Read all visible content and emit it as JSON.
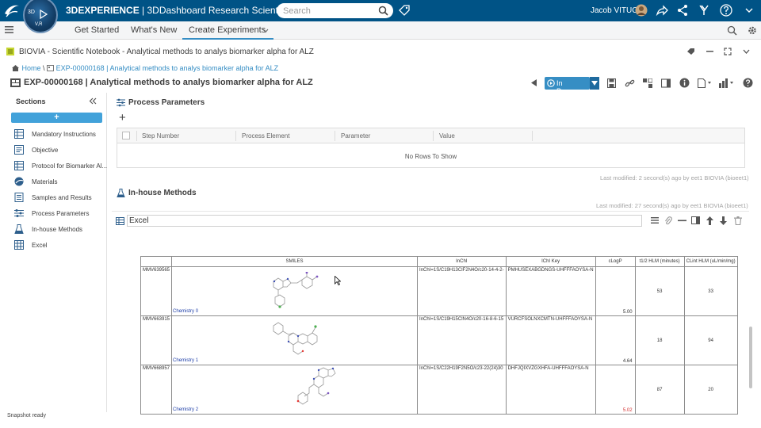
{
  "topbar": {
    "brand_bold": "3DEXPERIENCE",
    "brand_rest": " | 3DDashboard  Research Scientist",
    "search_placeholder": "Search",
    "user_name": "Jacob VITUCCI",
    "compass_3d": "3D",
    "compass_vr": "V,R"
  },
  "tabs": [
    {
      "label": "Get Started"
    },
    {
      "label": "What's New"
    },
    {
      "label": "Create Experiments"
    }
  ],
  "appbar": {
    "title": "BIOVIA - Scientific Notebook - Analytical methods to analys biomarker alpha for ALZ"
  },
  "breadcrumb": {
    "home": "Home",
    "sep": "\\",
    "experiment": "EXP-00000168 | Analytical methods to analys biomarker alpha for ALZ"
  },
  "experiment": {
    "title": "EXP-00000168 | Analytical methods to analys biomarker alpha for ALZ",
    "status": "In Progress"
  },
  "sidebar": {
    "label": "Sections",
    "add": "+",
    "items": [
      {
        "label": "Mandatory Instructions",
        "icon": "table-icon"
      },
      {
        "label": "Objective",
        "icon": "text-icon"
      },
      {
        "label": "Protocol for Biomarker Al...",
        "icon": "table-icon"
      },
      {
        "label": "Materials",
        "icon": "materials-icon"
      },
      {
        "label": "Samples and Results",
        "icon": "list-icon"
      },
      {
        "label": "Process Parameters",
        "icon": "parameters-icon"
      },
      {
        "label": "In-house Methods",
        "icon": "methods-icon"
      },
      {
        "label": "Excel",
        "icon": "table-icon"
      }
    ]
  },
  "process_parameters": {
    "title": "Process Parameters",
    "add": "+",
    "columns": [
      "Step Number",
      "Process Element",
      "Parameter",
      "Value"
    ],
    "empty": "No Rows To Show",
    "last_modified": "Last modified: 2 second(s) ago by eet1 BIOVIA (bioeet1)"
  },
  "inhouse": {
    "title": "In-house Methods",
    "last_modified": "Last modified: 27 second(s) ago by eet1 BIOVIA (bioeet1)"
  },
  "excel": {
    "name": "Excel",
    "headers": [
      "",
      "SMILES",
      "InChI",
      "IChI Key",
      "cLogP",
      "t1/2 HLM (minutes)",
      "CLint HLM (uL/min/mg)"
    ],
    "rows": [
      {
        "id": "MMV639565",
        "chem": "Chemistry 0",
        "inchi": "InChI=1S/C19H13ClF2N4O/c20-14-4-2-",
        "key": "PMHUSEXABGDNGS-UHFFFAOYSA-N",
        "clogp": "5.00",
        "t12": "53",
        "clint": "33"
      },
      {
        "id": "MMV663915",
        "chem": "Chemistry 1",
        "inchi": "InChI=1S/C19H15ClN4O/c20-16-8-6-15",
        "key": "VURCFSOLNXCMTN-UHFFFAOYSA-N",
        "clogp": "4.64",
        "t12": "18",
        "clint": "94"
      },
      {
        "id": "MMV668957",
        "chem": "Chemistry 2",
        "inchi": "InChI=1S/C22H19F2N5O/c23-22(24)30",
        "key": "DHFJQIXVZGXHFA-UHFFFAOYSA-N",
        "clogp": "5.02",
        "t12": "87",
        "clint": "20"
      }
    ]
  },
  "statusbar": {
    "text": "Snapshot ready"
  },
  "colors": {
    "topbar": "#005386",
    "accent": "#368ec4",
    "add_button": "#42a2da"
  }
}
